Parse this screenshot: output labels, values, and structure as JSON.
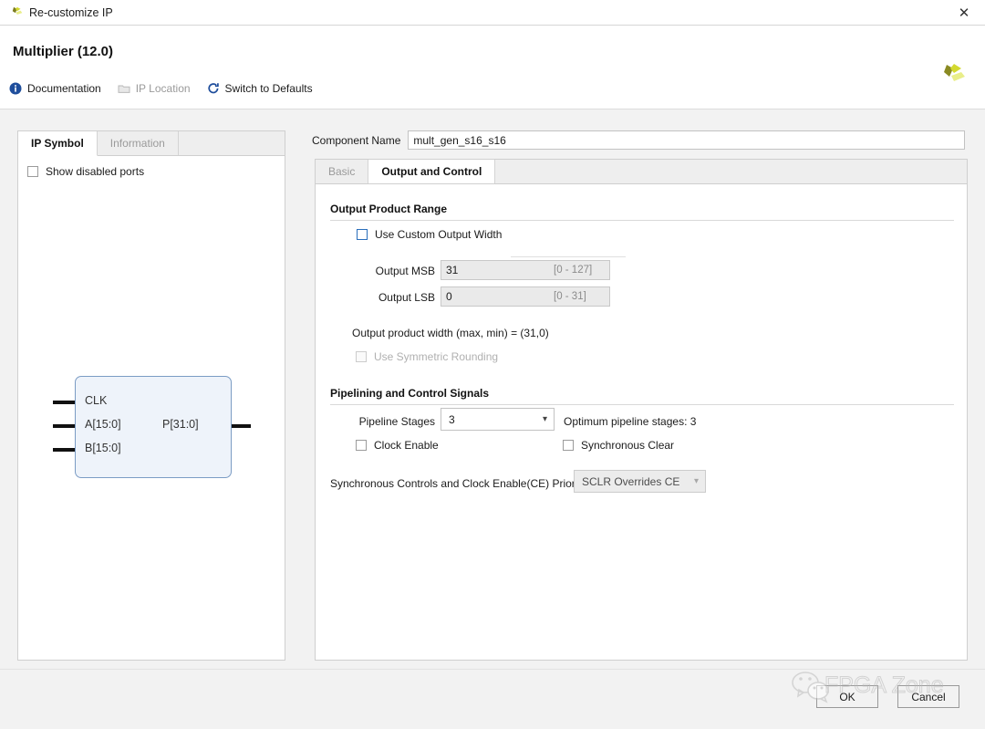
{
  "window": {
    "title": "Re-customize IP",
    "app_icon": "xilinx-logo-icon",
    "close_icon": "close-icon"
  },
  "header": {
    "ip_title": "Multiplier (12.0)",
    "logo_icon": "xilinx-logo-icon",
    "toolbar": [
      {
        "label": "Documentation",
        "icon": "info-icon",
        "disabled": false
      },
      {
        "label": "IP Location",
        "icon": "folder-icon",
        "disabled": true
      },
      {
        "label": "Switch to Defaults",
        "icon": "refresh-icon",
        "disabled": false
      }
    ]
  },
  "left_panel": {
    "tabs": [
      {
        "label": "IP Symbol",
        "active": true
      },
      {
        "label": "Information",
        "active": false
      }
    ],
    "show_disabled_ports": {
      "label": "Show disabled ports",
      "checked": false
    },
    "symbol": {
      "inputs": [
        "CLK",
        "A[15:0]",
        "B[15:0]"
      ],
      "outputs": [
        "P[31:0]"
      ]
    }
  },
  "right_panel": {
    "component_name": {
      "label": "Component Name",
      "value": "mult_gen_s16_s16"
    },
    "tabs": [
      {
        "label": "Basic",
        "active": false
      },
      {
        "label": "Output and Control",
        "active": true
      }
    ],
    "output_product_range": {
      "title": "Output Product Range",
      "use_custom_output_width": {
        "label": "Use Custom Output Width",
        "checked": false
      },
      "output_msb": {
        "label": "Output MSB",
        "value": "31",
        "range": "[0 - 127]"
      },
      "output_lsb": {
        "label": "Output LSB",
        "value": "0",
        "range": "[0 - 31]"
      },
      "width_summary": "Output product width (max, min) = (31,0)",
      "use_symmetric_rounding": {
        "label": "Use Symmetric Rounding",
        "checked": false,
        "disabled": true
      }
    },
    "pipelining": {
      "title": "Pipelining and Control Signals",
      "pipeline_stages": {
        "label": "Pipeline Stages",
        "value": "3"
      },
      "optimum_note": "Optimum pipeline stages: 3",
      "clock_enable": {
        "label": "Clock Enable",
        "checked": false
      },
      "synchronous_clear": {
        "label": "Synchronous Clear",
        "checked": false
      },
      "priority": {
        "label": "Synchronous Controls and Clock Enable(CE) Priority",
        "value": "SCLR Overrides CE",
        "disabled": true
      }
    }
  },
  "footer": {
    "ok_label": "OK",
    "cancel_label": "Cancel"
  },
  "watermark": {
    "text": "FPGA Zone",
    "icon": "wechat-icon"
  },
  "colors": {
    "accent_blue": "#2a6ebb",
    "logo_yellow": "#cfd430",
    "logo_olive": "#7d7d20",
    "symbol_fill": "#eef3fa",
    "symbol_border": "#7b9cc4"
  }
}
